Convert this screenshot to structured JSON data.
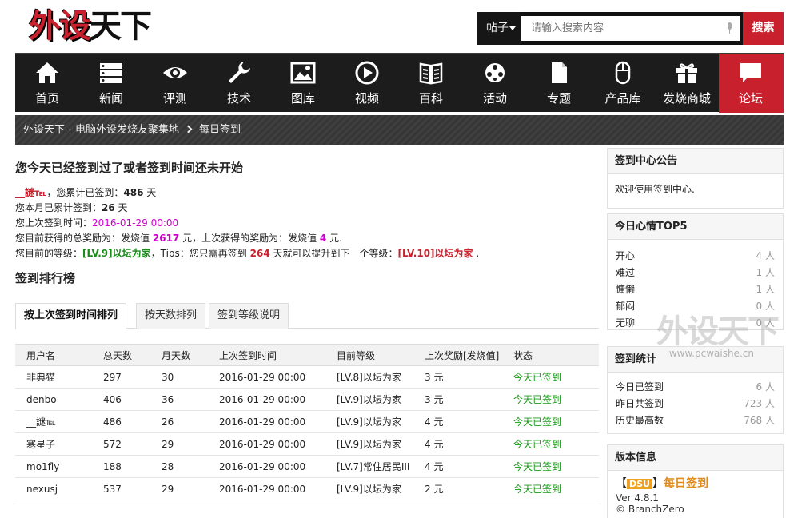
{
  "header": {
    "logo_text_red": "外设",
    "logo_text_black": "天下",
    "search": {
      "category": "帖子",
      "placeholder": "请输入搜索内容",
      "button": "搜索"
    }
  },
  "nav": {
    "items": [
      {
        "label": "首页",
        "icon": "home-icon"
      },
      {
        "label": "新闻",
        "icon": "news-icon"
      },
      {
        "label": "评测",
        "icon": "eye-icon"
      },
      {
        "label": "技术",
        "icon": "wrench-icon"
      },
      {
        "label": "图库",
        "icon": "picture-icon"
      },
      {
        "label": "视频",
        "icon": "play-icon"
      },
      {
        "label": "百科",
        "icon": "book-icon"
      },
      {
        "label": "活动",
        "icon": "activity-icon"
      },
      {
        "label": "专题",
        "icon": "document-icon"
      },
      {
        "label": "产品库",
        "icon": "mouse-icon"
      },
      {
        "label": "发烧商城",
        "icon": "gift-icon"
      },
      {
        "label": "论坛",
        "icon": "chat-icon"
      }
    ],
    "active_color": "#c8202d"
  },
  "breadcrumb": {
    "home": "外设天下 - 电脑外设发烧友聚集地",
    "current": "每日签到"
  },
  "status": {
    "title": "您今天已经签到过了或者签到时间还未开始",
    "user": "__謎℡",
    "total_prefix": "，您累计已签到：",
    "total_days": "486",
    "total_suffix": "天",
    "month_prefix": "您本月已累计签到：",
    "month_days": "26",
    "month_suffix": "天",
    "last_prefix": "您上次签到时间：",
    "last_time": "2016-01-29 00:00",
    "reward_prefix": "您目前获得的总奖励为：发烧值",
    "reward_total": "2617",
    "reward_mid": "元，上次获得的奖励为：发烧值",
    "reward_last": "4",
    "reward_suffix": "元.",
    "level_prefix": "您目前的等级：",
    "level_current": "[LV.9]以坛为家",
    "level_mid": "，Tips：您只需再签到",
    "level_days": "264",
    "level_mid2": "天就可以提升到下一个等级：",
    "level_next": "[LV.10]以坛为家",
    "level_suffix": "."
  },
  "ranking": {
    "title": "签到排行榜",
    "tabs": [
      "按上次签到时间排列",
      "按天数排列",
      "签到等级说明"
    ],
    "columns": [
      "用户名",
      "总天数",
      "月天数",
      "上次签到时间",
      "目前等级",
      "上次奖励[发烧值]",
      "状态"
    ],
    "rows": [
      [
        "非典猫",
        "297",
        "30",
        "2016-01-29 00:00",
        "[LV.8]以坛为家",
        "3 元",
        "今天已签到"
      ],
      [
        "denbo",
        "406",
        "36",
        "2016-01-29 00:00",
        "[LV.9]以坛为家",
        "3 元",
        "今天已签到"
      ],
      [
        "__謎℡",
        "486",
        "26",
        "2016-01-29 00:00",
        "[LV.9]以坛为家",
        "4 元",
        "今天已签到"
      ],
      [
        "寒星子",
        "572",
        "29",
        "2016-01-29 00:00",
        "[LV.9]以坛为家",
        "4 元",
        "今天已签到"
      ],
      [
        "mo1fly",
        "188",
        "28",
        "2016-01-29 00:00",
        "[LV.7]常住居民III",
        "4 元",
        "今天已签到"
      ],
      [
        "nexusj",
        "537",
        "29",
        "2016-01-29 00:00",
        "[LV.9]以坛为家",
        "2 元",
        "今天已签到"
      ]
    ]
  },
  "sidebar": {
    "notice": {
      "title": "签到中心公告",
      "text": "欢迎使用签到中心."
    },
    "mood": {
      "title": "今日心情TOP5",
      "items": [
        {
          "label": "开心",
          "value": "4 人"
        },
        {
          "label": "难过",
          "value": "1 人"
        },
        {
          "label": "慵懒",
          "value": "1 人"
        },
        {
          "label": "郁闷",
          "value": "0 人"
        },
        {
          "label": "无聊",
          "value": "0 人"
        }
      ]
    },
    "stats": {
      "title": "签到统计",
      "items": [
        {
          "label": "今日已签到",
          "value": "6 人"
        },
        {
          "label": "昨日共签到",
          "value": "723 人"
        },
        {
          "label": "历史最高数",
          "value": "768 人"
        }
      ]
    },
    "version": {
      "title": "版本信息",
      "badge": "DSU",
      "name": "每日签到",
      "ver": "Ver 4.8.1",
      "author": "© BranchZero"
    }
  },
  "watermark": {
    "text": "外设天下",
    "url": "www.pcwaishe.cn"
  }
}
